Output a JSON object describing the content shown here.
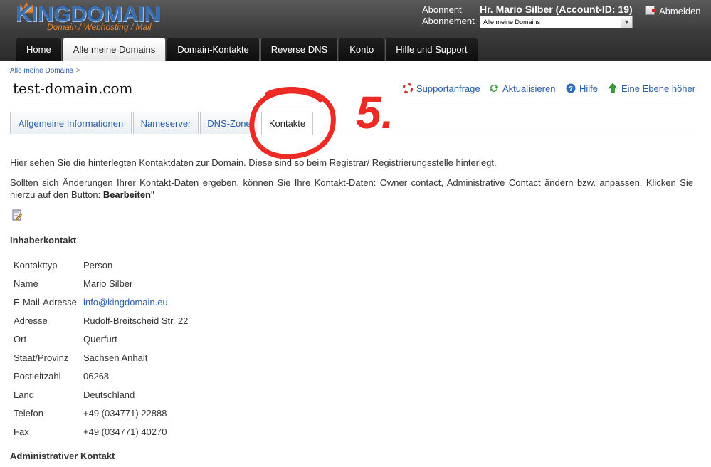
{
  "header": {
    "logo_text": "KINGDOMAIN",
    "logo_tagline": "Domain / Webhosting / Mail",
    "account_label": "Abonnent",
    "subscription_label": "Abonnement",
    "account_name": "Hr. Mario Silber (Account-ID: 19)",
    "subscription_select": "Alle meine Domains",
    "logout": "Abmelden"
  },
  "nav": {
    "items": [
      {
        "label": "Home"
      },
      {
        "label": "Alle meine Domains"
      },
      {
        "label": "Domain-Kontakte"
      },
      {
        "label": "Reverse DNS"
      },
      {
        "label": "Konto"
      },
      {
        "label": "Hilfe und Support"
      }
    ],
    "active": "Alle meine Domains"
  },
  "breadcrumb": {
    "item": "Alle meine Domains",
    "separator": ">"
  },
  "page_title": "test-domain.com",
  "actions": [
    {
      "label": "Supportanfrage",
      "icon": "lifebuoy-icon"
    },
    {
      "label": "Aktualisieren",
      "icon": "refresh-icon"
    },
    {
      "label": "Hilfe",
      "icon": "help-icon"
    },
    {
      "label": "Eine Ebene höher",
      "icon": "arrow-up-icon"
    }
  ],
  "tabs": [
    {
      "label": "Allgemeine Informationen"
    },
    {
      "label": "Nameserver"
    },
    {
      "label": "DNS-Zone"
    },
    {
      "label": "Kontakte"
    }
  ],
  "active_tab": "Kontakte",
  "annotation": "5.",
  "intro": "Hier sehen Sie die hinterlegten Kontaktdaten zur Domain. Diese sind so beim Registrar/ Registrierungsstelle hinterlegt.",
  "info_text": "Sollten sich Änderungen Ihrer Kontakt-Daten ergeben, können Sie Ihre Kontakt-Daten: Owner contact, Administrative Contact ändern bzw. anpassen. Klicken Sie hierzu auf den Button: ",
  "info_button_ref": "Bearbeiten",
  "info_quote": "\"",
  "edit_icon": "edit-icon",
  "owner_contact": {
    "heading": "Inhaberkontakt",
    "fields": [
      {
        "label": "Kontakttyp",
        "value": "Person"
      },
      {
        "label": "Name",
        "value": "Mario Silber"
      },
      {
        "label": "E-Mail-Adresse",
        "value": "info@kingdomain.eu"
      },
      {
        "label": "Adresse",
        "value": "Rudolf-Breitscheid Str. 22"
      },
      {
        "label": "Ort",
        "value": "Querfurt"
      },
      {
        "label": "Staat/Provinz",
        "value": "Sachsen Anhalt"
      },
      {
        "label": "Postleitzahl",
        "value": "06268"
      },
      {
        "label": "Land",
        "value": "Deutschland"
      },
      {
        "label": "Telefon",
        "value": "+49 (034771) 22888"
      },
      {
        "label": "Fax",
        "value": "+49 (034771) 40270"
      }
    ]
  },
  "admin_contact": {
    "heading": "Administrativer Kontakt"
  },
  "colors": {
    "link": "#2a5ea8",
    "header_bg": "#3a3a3a",
    "annotation": "#ee2a24",
    "logo_blue": "#3c6fb0",
    "logo_orange": "#e0873a"
  }
}
